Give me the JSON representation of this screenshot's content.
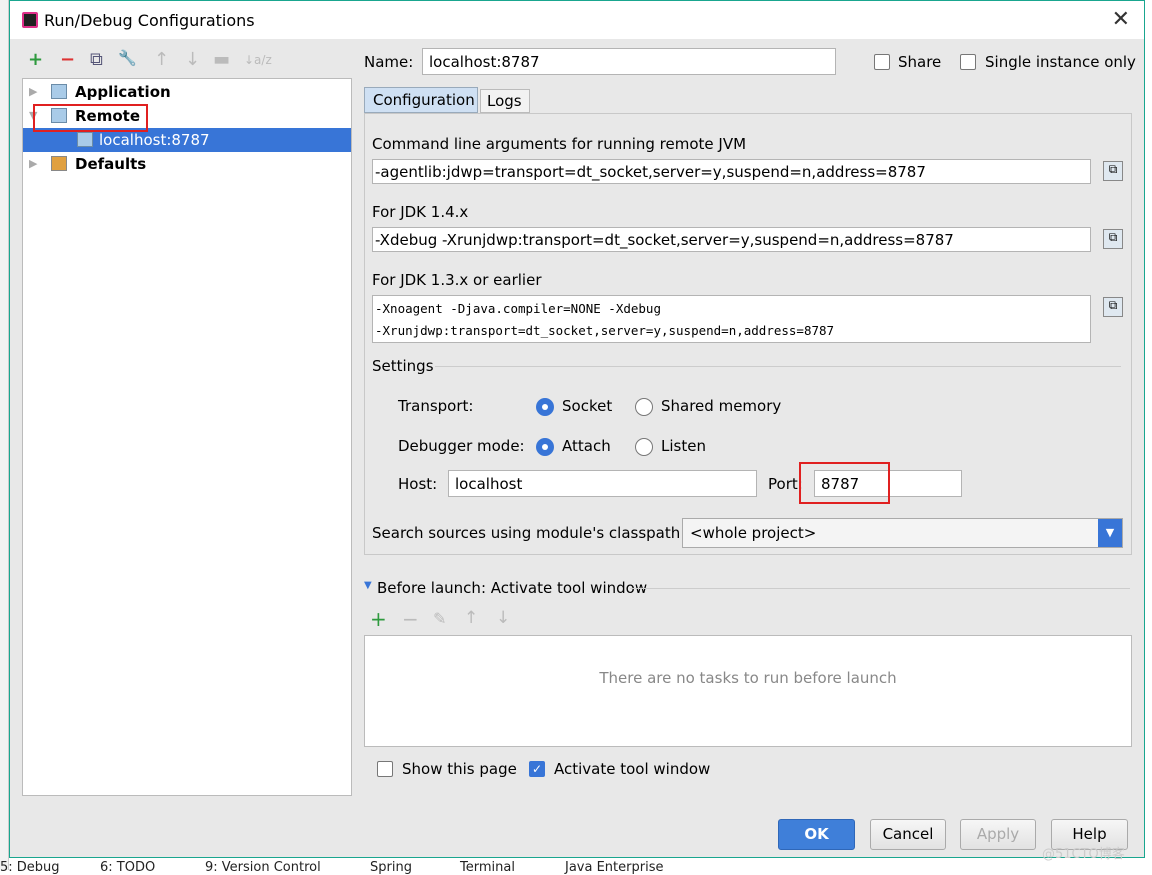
{
  "window": {
    "title": "Run/Debug Configurations",
    "close": "✕"
  },
  "toolbar": [
    "+",
    "−",
    "⧉",
    "🔧",
    "↑",
    "↓",
    "▬",
    "↓a/z"
  ],
  "tree": {
    "items": [
      {
        "label": "Application",
        "expanded": false
      },
      {
        "label": "Remote",
        "expanded": true,
        "highlighted": true
      },
      {
        "label": "localhost:8787",
        "selected": true
      },
      {
        "label": "Defaults",
        "expanded": false
      }
    ]
  },
  "name": {
    "label": "Name:",
    "value": "localhost:8787"
  },
  "share": {
    "label": "Share",
    "checked": false
  },
  "single_instance": {
    "label": "Single instance only",
    "checked": false
  },
  "tabs": [
    {
      "label": "Configuration",
      "active": true
    },
    {
      "label": "Logs",
      "active": false
    }
  ],
  "cmd": {
    "label": "Command line arguments for running remote JVM",
    "value": "-agentlib:jdwp=transport=dt_socket,server=y,suspend=n,address=8787"
  },
  "jdk14": {
    "label": "For JDK 1.4.x",
    "value": "-Xdebug -Xrunjdwp:transport=dt_socket,server=y,suspend=n,address=8787"
  },
  "jdk13": {
    "label": "For JDK 1.3.x or earlier",
    "line1": "-Xnoagent -Djava.compiler=NONE -Xdebug",
    "line2": "-Xrunjdwp:transport=dt_socket,server=y,suspend=n,address=8787"
  },
  "settings": {
    "label": "Settings",
    "transport": {
      "label": "Transport:",
      "options": [
        "Socket",
        "Shared memory"
      ],
      "selected": "Socket"
    },
    "mode": {
      "label": "Debugger mode:",
      "options": [
        "Attach",
        "Listen"
      ],
      "selected": "Attach"
    },
    "host": {
      "label": "Host:",
      "value": "localhost"
    },
    "port": {
      "label": "Port:",
      "value": "8787"
    }
  },
  "classpath": {
    "label": "Search sources using module's classpath:",
    "value": "<whole project>"
  },
  "before_launch": {
    "label": "Before launch: Activate tool window",
    "empty": "There are no tasks to run before launch",
    "tools": [
      "+",
      "−",
      "✎",
      "↑",
      "↓"
    ]
  },
  "show_page": {
    "label": "Show this page",
    "checked": false
  },
  "activate_tool": {
    "label": "Activate tool window",
    "checked": true
  },
  "buttons": {
    "ok": "OK",
    "cancel": "Cancel",
    "apply": "Apply",
    "help": "Help"
  },
  "taskbar": [
    "5: Debug",
    "6: TODO",
    "9: Version Control",
    "Spring",
    "Terminal",
    "Java Enterprise"
  ],
  "watermark": "@51CTO博客",
  "colors": {
    "accent": "#3875d7",
    "highlight_box": "#e02020"
  }
}
